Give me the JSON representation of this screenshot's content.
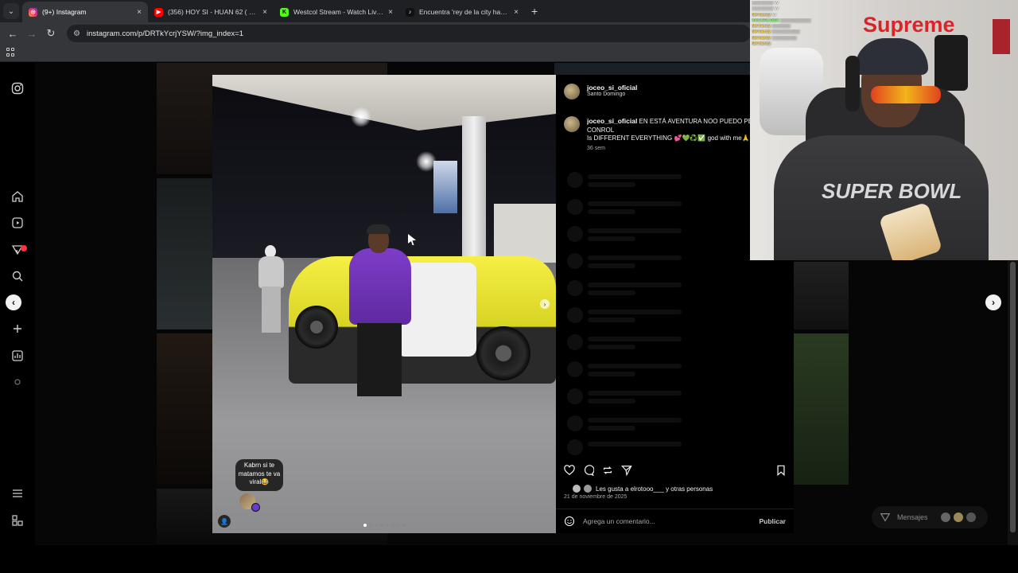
{
  "browser": {
    "tabs": [
      {
        "title": "(9+) Instagram",
        "favicon": "instagram-favicon",
        "color": "#e1306c",
        "active": true
      },
      {
        "title": "(356) HOY SI - HUAN 62 ( VIDE",
        "favicon": "youtube-favicon",
        "color": "#ff0000",
        "active": false
      },
      {
        "title": "Westcol Stream - Watch Live o",
        "favicon": "kick-favicon",
        "color": "#53fc18",
        "active": false
      },
      {
        "title": "Encuentra 'rey de la city habla",
        "favicon": "tiktok-favicon",
        "color": "#111111",
        "active": false
      }
    ],
    "new_tab_icon": "+",
    "close_icon": "×",
    "url": "instagram.com/p/DRTkYcrjYSW/?img_index=1"
  },
  "post": {
    "username": "joceo_si_oficial",
    "location": "Santo Domingo",
    "caption_user": "joceo_si_oficial",
    "caption_text": " EN ESTÁ AVENTURA NOO PUEDO PERDER CONROL",
    "caption_line2": "Is DIFFERENT EVERYTHING 💕💚♻️✅ god with me🙏",
    "caption_time": "36 sem",
    "likes_text": "Les gusta a elrotooo___ y otras personas",
    "date": "21 de noviembre de 2025",
    "comment_placeholder": "Agrega un comentario...",
    "publish_label": "Publicar",
    "bubble_text": "Kabrn si te matamos te va viral😂",
    "carousel_count": 8,
    "carousel_index": 0
  },
  "messages": {
    "label": "Mensajes"
  },
  "webcam": {
    "brand_text": "Supreme",
    "shirt_text": "SUPER BOWL",
    "chat": [
      {
        "who": "",
        "msg": "W",
        "cls": "g"
      },
      {
        "who": "",
        "msg": "W",
        "cls": "g"
      },
      {
        "who": "NKYandy",
        "msg": "W",
        "cls": "y"
      },
      {
        "who": "XXCARLOSX",
        "msg": "",
        "cls": "g"
      },
      {
        "who": "NKYandy",
        "msg": "",
        "cls": "y"
      },
      {
        "who": "NKYandy",
        "msg": "",
        "cls": "y"
      },
      {
        "who": "NKYandy",
        "msg": "",
        "cls": "y"
      },
      {
        "who": "NKYandy",
        "msg": "",
        "cls": "y"
      }
    ]
  }
}
